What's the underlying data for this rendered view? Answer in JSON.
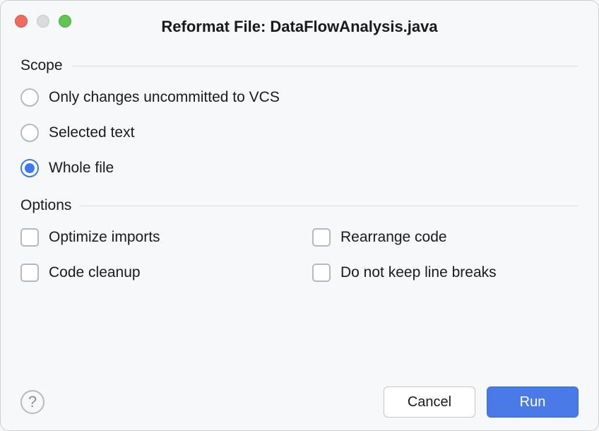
{
  "title": "Reformat File: DataFlowAnalysis.java",
  "sections": {
    "scope": {
      "label": "Scope",
      "options": [
        {
          "label": "Only changes uncommitted to VCS",
          "selected": false
        },
        {
          "label": "Selected text",
          "selected": false
        },
        {
          "label": "Whole file",
          "selected": true
        }
      ]
    },
    "options": {
      "label": "Options",
      "items": {
        "optimize_imports": "Optimize imports",
        "rearrange_code": "Rearrange code",
        "code_cleanup": "Code cleanup",
        "keep_line_breaks": "Do not keep line breaks"
      }
    }
  },
  "help_glyph": "?",
  "buttons": {
    "cancel": "Cancel",
    "run": "Run"
  }
}
